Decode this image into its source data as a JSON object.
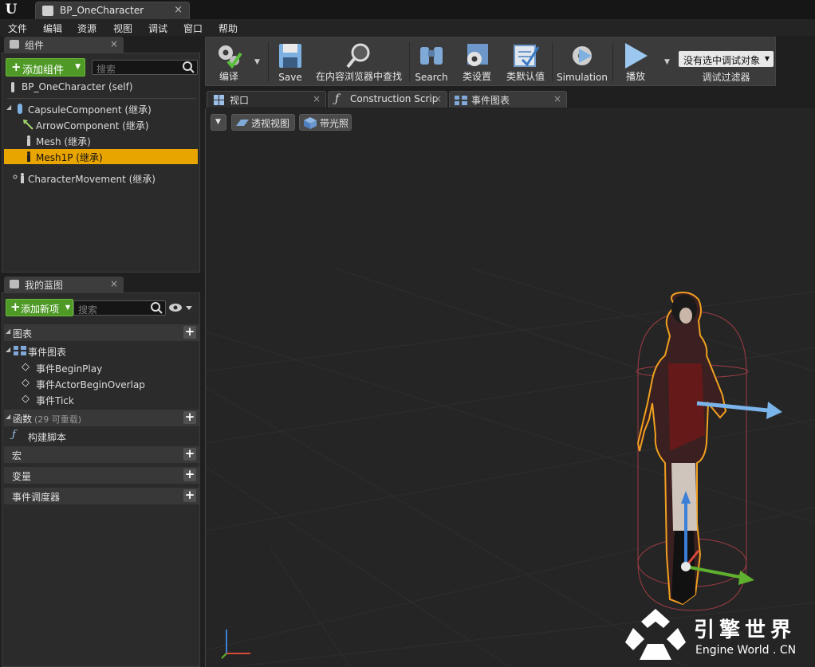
{
  "window": {
    "tab_title": "BP_OneCharacter",
    "close_glyph": "×"
  },
  "menu": [
    "文件",
    "编辑",
    "资源",
    "视图",
    "调试",
    "窗口",
    "帮助"
  ],
  "components_panel": {
    "tab_label": "组件",
    "add_button": "添加组件",
    "search_placeholder": "搜索",
    "items": [
      {
        "label": "BP_OneCharacter (self)",
        "icon": "self-icon"
      },
      {
        "label": "CapsuleComponent (继承)",
        "icon": "capsule-icon"
      },
      {
        "label": "ArrowComponent (继承)",
        "icon": "arrow-icon"
      },
      {
        "label": "Mesh (继承)",
        "icon": "mesh-icon"
      },
      {
        "label": "Mesh1P (继承)",
        "icon": "mesh-icon",
        "selected": true
      },
      {
        "label": "CharacterMovement (继承)",
        "icon": "movement-icon"
      }
    ]
  },
  "my_blueprint_panel": {
    "tab_label": "我的蓝图",
    "add_button": "添加新项",
    "search_placeholder": "搜索",
    "graphs_header": "图表",
    "event_graph": "事件图表",
    "events": [
      "事件BeginPlay",
      "事件ActorBeginOverlap",
      "事件Tick"
    ],
    "functions_header": "函数",
    "functions_count": "(29 可重载)",
    "construction_script": "构建脚本",
    "macros_header": "宏",
    "variables_header": "变量",
    "dispatchers_header": "事件调度器"
  },
  "toolbar": {
    "compile": "编译",
    "save": "Save",
    "find_in_cb": "在内容浏览器中查找",
    "search": "Search",
    "class_settings": "类设置",
    "class_defaults": "类默认值",
    "simulation": "Simulation",
    "play": "播放",
    "debug_object": "没有选中调试对象",
    "debug_filter": "调试过滤器"
  },
  "editor_tabs": [
    {
      "label": "视口",
      "icon": "viewport-icon"
    },
    {
      "label": "Construction Scrip",
      "icon": "function-icon"
    },
    {
      "label": "事件图表",
      "icon": "graph-icon"
    }
  ],
  "viewport": {
    "perspective": "透视视图",
    "lit": "带光照"
  },
  "watermark": {
    "title": "引擎世界",
    "subtitle": "Engine World . CN"
  },
  "colors": {
    "selection": "#e8a500",
    "add_green": "#4f9a27",
    "bg": "#252525"
  }
}
